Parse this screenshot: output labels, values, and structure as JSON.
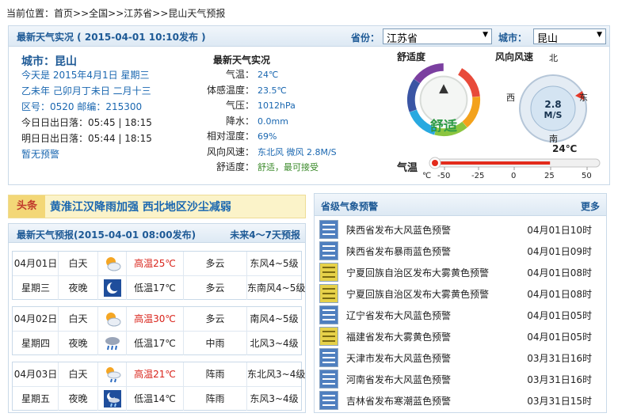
{
  "breadcrumb": {
    "prefix": "当前位置：",
    "items": [
      "首页",
      ">>",
      "全国",
      ">>",
      "江苏省",
      ">>",
      "昆山天气预报"
    ]
  },
  "live": {
    "title": "最新天气实况 ( 2015-04-01 10:10发布 )",
    "province_label": "省份：",
    "province_value": "江苏省",
    "city_label": "城市：",
    "city_value": "昆山",
    "city_heading": "城市：昆山",
    "info": {
      "today": "今天是 2015年4月1日 星期三",
      "lunar": "乙未年 己卯月丁未日 二月十三",
      "codes": "区号：0520 邮编：215300",
      "sun_today": "今日日出日落：05:45 | 18:15",
      "sun_tomorrow": "明日日出日落：05:44 | 18:15",
      "warning": "暂无预警"
    },
    "obs_title": "最新天气实况",
    "obs": [
      {
        "k": "气温：",
        "v": "24℃"
      },
      {
        "k": "体感温度：",
        "v": "23.5℃"
      },
      {
        "k": "气压：",
        "v": "1012hPa"
      },
      {
        "k": "降水：",
        "v": "0.0mm"
      },
      {
        "k": "相对湿度：",
        "v": "69%"
      },
      {
        "k": "风向风速：",
        "v": "东北风 微风 2.8M/S"
      },
      {
        "k": "舒适度：",
        "v": "舒适，最可接受"
      }
    ],
    "comfort_title": "舒适度",
    "comfort_value": "舒适",
    "wind_title": "风向风速",
    "wind_speed": "2.8",
    "wind_unit": "M/S",
    "wind_dirs": {
      "n": "北",
      "s": "南",
      "e": "东",
      "w": "西"
    },
    "temp_label": "气温",
    "temp_now": "24℃",
    "temp_unit": "℃",
    "temp_value": 24,
    "temp_ticks": [
      "-50",
      "-25",
      "0",
      "25",
      "50"
    ]
  },
  "headline": {
    "tag": "头条",
    "text": "黄淮江汉降雨加强  西北地区沙尘减弱"
  },
  "forecast": {
    "title": "最新天气预报(2015-04-01  08:00发布)",
    "more": "未来4～7天预报",
    "days": [
      {
        "date": "04月01日",
        "week": "星期三",
        "day": {
          "label": "白天",
          "icon": "sun-cloud-icon",
          "temp": "高温25℃",
          "wx": "多云",
          "wind": "东风4~5级"
        },
        "night": {
          "label": "夜晚",
          "icon": "moon-icon",
          "temp": "低温17℃",
          "wx": "多云",
          "wind": "东南风4~5级"
        }
      },
      {
        "date": "04月02日",
        "week": "星期四",
        "day": {
          "label": "白天",
          "icon": "sun-cloud-icon",
          "temp": "高温30℃",
          "wx": "多云",
          "wind": "南风4~5级"
        },
        "night": {
          "label": "夜晚",
          "icon": "rain-cloud-icon",
          "temp": "低温17℃",
          "wx": "中雨",
          "wind": "北风3~4级"
        }
      },
      {
        "date": "04月03日",
        "week": "星期五",
        "day": {
          "label": "白天",
          "icon": "sun-rain-icon",
          "temp": "高温21℃",
          "wx": "阵雨",
          "wind": "东北风3~4级"
        },
        "night": {
          "label": "夜晚",
          "icon": "moon-rain-icon",
          "temp": "低温14℃",
          "wx": "阵雨",
          "wind": "东风3~4级"
        }
      }
    ]
  },
  "alerts": {
    "title": "省级气象预警",
    "more": "更多",
    "items": [
      {
        "text": "陕西省发布大风蓝色预警",
        "date": "04月01日10时",
        "color": "blue"
      },
      {
        "text": "陕西省发布暴雨蓝色预警",
        "date": "04月01日09时",
        "color": "blue"
      },
      {
        "text": "宁夏回族自治区发布大雾黄色预警",
        "date": "04月01日08时",
        "color": "yellow"
      },
      {
        "text": "宁夏回族自治区发布大雾黄色预警",
        "date": "04月01日08时",
        "color": "yellow"
      },
      {
        "text": "辽宁省发布大风蓝色预警",
        "date": "04月01日05时",
        "color": "blue"
      },
      {
        "text": "福建省发布大雾黄色预警",
        "date": "04月01日05时",
        "color": "yellow"
      },
      {
        "text": "天津市发布大风蓝色预警",
        "date": "03月31日16时",
        "color": "blue"
      },
      {
        "text": "河南省发布大风蓝色预警",
        "date": "03月31日16时",
        "color": "blue"
      },
      {
        "text": "吉林省发布寒潮蓝色预警",
        "date": "03月31日15时",
        "color": "blue"
      }
    ]
  }
}
